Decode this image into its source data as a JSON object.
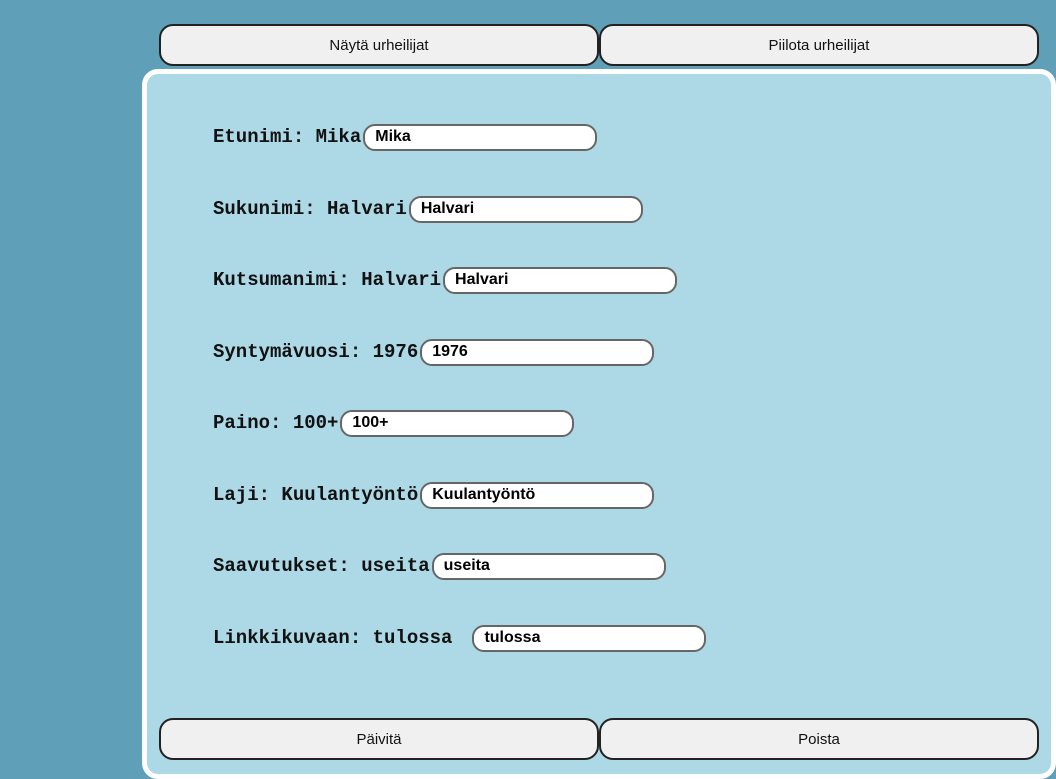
{
  "top_buttons": {
    "show_label": "Näytä urheilijat",
    "hide_label": "Piilota urheilijat"
  },
  "form": {
    "fields": [
      {
        "label": "Etunimi: Mika",
        "value": "Mika"
      },
      {
        "label": "Sukunimi: Halvari",
        "value": "Halvari"
      },
      {
        "label": "Kutsumanimi: Halvari",
        "value": "Halvari"
      },
      {
        "label": "Syntymävuosi: 1976",
        "value": "1976"
      },
      {
        "label": "Paino: 100+",
        "value": "100+"
      },
      {
        "label": "Laji: Kuulantyöntö",
        "value": "Kuulantyöntö"
      },
      {
        "label": "Saavutukset: useita",
        "value": "useita"
      },
      {
        "label": "Linkkikuvaan: tulossa",
        "value": "tulossa"
      }
    ]
  },
  "bottom_buttons": {
    "update_label": "Päivitä",
    "delete_label": "Poista"
  },
  "colors": {
    "page_background": "#5f9fb8",
    "panel_background": "#add8e6",
    "button_background": "#f0f0f0"
  }
}
